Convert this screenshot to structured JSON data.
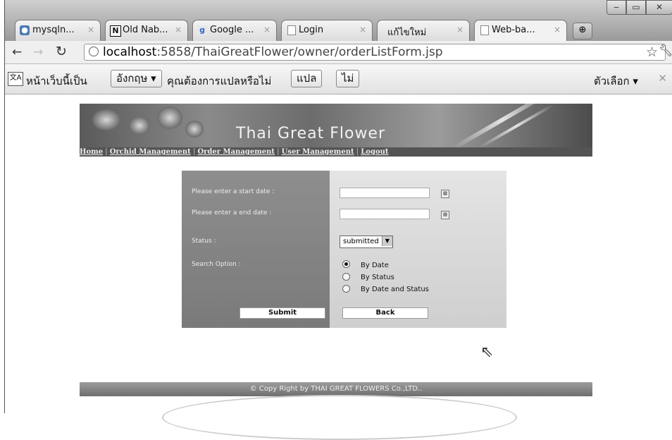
{
  "browser": {
    "tabs": [
      {
        "icon": "mysql",
        "label": "mysqln..."
      },
      {
        "icon": "N",
        "label": "Old Nab..."
      },
      {
        "icon": "google",
        "label": "Google ..."
      },
      {
        "icon": "page",
        "label": "Login"
      },
      {
        "icon": "",
        "label": "แก้ไขใหม่"
      },
      {
        "icon": "page",
        "label": "Web-ba..."
      }
    ],
    "url_host": "localhost",
    "url_rest": ":5858/ThaiGreatFlower/owner/orderListForm.jsp"
  },
  "translate_bar": {
    "prefix": "หน้าเว็บนี้เป็น",
    "language": "อังกฤษ",
    "question": "คุณต้องการแปลหรือไม่",
    "translate_button": "แปล",
    "no_button": "ไม่",
    "options": "ตัวเลือก"
  },
  "page": {
    "banner_title": "Thai Great Flower",
    "nav": [
      "Home",
      "Orchid Management",
      "Order Management",
      "User Management",
      "Logout"
    ],
    "form": {
      "start_date_label": "Please enter a start date :",
      "end_date_label": "Please enter a end date :",
      "status_label": "Status :",
      "status_value": "submitted",
      "search_option_label": "Search Option :",
      "options": [
        "By Date",
        "By Status",
        "By Date and Status"
      ],
      "selected_option": 0,
      "submit_label": "Submit",
      "back_label": "Back"
    },
    "footer": "© Copy Right by THAI GREAT FLOWERS Co.,LTD.."
  }
}
